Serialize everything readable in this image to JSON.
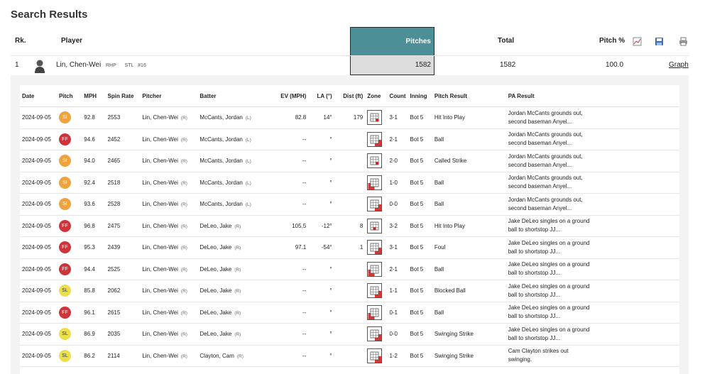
{
  "page_title": "Search Results",
  "header": {
    "rank": "Rk.",
    "player": "Player",
    "pitches": "Pitches",
    "total": "Total",
    "pitch_pct": "Pitch %"
  },
  "summary": {
    "rank": "1",
    "player_name": "Lin, Chen-Wei",
    "throws": "RHP",
    "team": "STL",
    "number": "#16",
    "pitches": "1582",
    "total": "1582",
    "pitch_pct": "100.0",
    "graph_link": "Graph"
  },
  "colors": {
    "accent": "#4c8f96",
    "SI": "#f0a23c",
    "FF": "#d0343b",
    "SL": "#ece04a",
    "zone_fill": "#d02020"
  },
  "columns": [
    "Date",
    "Pitch",
    "MPH",
    "Spin Rate",
    "Pitcher",
    "Batter",
    "EV (MPH)",
    "LA (°)",
    "Dist (ft)",
    "Zone",
    "Count",
    "Inning",
    "Pitch Result",
    "PA Result"
  ],
  "rows": [
    {
      "date": "2024-09-05",
      "pitch": "SI",
      "mph": "92.8",
      "spin": "2553",
      "pitcher": "Lin, Chen-Wei",
      "p_hand": "(R)",
      "batter": "McCants, Jordan",
      "b_hand": "(L)",
      "ev": "82.8",
      "la": "14°",
      "dist": "179",
      "zone": "9",
      "count": "3-1",
      "inning": "Bot 5",
      "result": "Hit Into Play",
      "pa": "Jordan McCants grounds out, second baseman Anyel..."
    },
    {
      "date": "2024-09-05",
      "pitch": "FF",
      "mph": "94.6",
      "spin": "2452",
      "pitcher": "Lin, Chen-Wei",
      "p_hand": "(R)",
      "batter": "McCants, Jordan",
      "b_hand": "(L)",
      "ev": "--",
      "la": "°",
      "dist": "",
      "zone": "14",
      "count": "2-1",
      "inning": "Bot 5",
      "result": "Ball",
      "pa": "Jordan McCants grounds out, second baseman Anyel..."
    },
    {
      "date": "2024-09-05",
      "pitch": "SI",
      "mph": "94.0",
      "spin": "2465",
      "pitcher": "Lin, Chen-Wei",
      "p_hand": "(R)",
      "batter": "McCants, Jordan",
      "b_hand": "(L)",
      "ev": "--",
      "la": "°",
      "dist": "",
      "zone": "9",
      "count": "2-0",
      "inning": "Bot 5",
      "result": "Called Strike",
      "pa": "Jordan McCants grounds out, second baseman Anyel..."
    },
    {
      "date": "2024-09-05",
      "pitch": "SI",
      "mph": "92.4",
      "spin": "2518",
      "pitcher": "Lin, Chen-Wei",
      "p_hand": "(R)",
      "batter": "McCants, Jordan",
      "b_hand": "(L)",
      "ev": "--",
      "la": "°",
      "dist": "",
      "zone": "13",
      "count": "1-0",
      "inning": "Bot 5",
      "result": "Ball",
      "pa": "Jordan McCants grounds out, second baseman Anyel..."
    },
    {
      "date": "2024-09-05",
      "pitch": "SI",
      "mph": "93.6",
      "spin": "2528",
      "pitcher": "Lin, Chen-Wei",
      "p_hand": "(R)",
      "batter": "McCants, Jordan",
      "b_hand": "(L)",
      "ev": "--",
      "la": "°",
      "dist": "",
      "zone": "14",
      "count": "0-0",
      "inning": "Bot 5",
      "result": "Ball",
      "pa": "Jordan McCants grounds out, second baseman Anyel..."
    },
    {
      "date": "2024-09-05",
      "pitch": "FF",
      "mph": "96.8",
      "spin": "2475",
      "pitcher": "Lin, Chen-Wei",
      "p_hand": "(R)",
      "batter": "DeLeo, Jake",
      "b_hand": "(R)",
      "ev": "105.5",
      "la": "-12°",
      "dist": "8",
      "zone": "8",
      "count": "3-2",
      "inning": "Bot 5",
      "result": "Hit Into Play",
      "pa": "Jake DeLeo singles on a ground ball to shortstop JJ..."
    },
    {
      "date": "2024-09-05",
      "pitch": "FF",
      "mph": "95.3",
      "spin": "2439",
      "pitcher": "Lin, Chen-Wei",
      "p_hand": "(R)",
      "batter": "DeLeo, Jake",
      "b_hand": "(R)",
      "ev": "97.1",
      "la": "-54°",
      "dist": "1",
      "zone": "14",
      "count": "3-1",
      "inning": "Bot 5",
      "result": "Foul",
      "pa": "Jake DeLeo singles on a ground ball to shortstop JJ..."
    },
    {
      "date": "2024-09-05",
      "pitch": "FF",
      "mph": "94.4",
      "spin": "2525",
      "pitcher": "Lin, Chen-Wei",
      "p_hand": "(R)",
      "batter": "DeLeo, Jake",
      "b_hand": "(R)",
      "ev": "--",
      "la": "°",
      "dist": "",
      "zone": "13",
      "count": "2-1",
      "inning": "Bot 5",
      "result": "Ball",
      "pa": "Jake DeLeo singles on a ground ball to shortstop JJ..."
    },
    {
      "date": "2024-09-05",
      "pitch": "SL",
      "mph": "85.8",
      "spin": "2062",
      "pitcher": "Lin, Chen-Wei",
      "p_hand": "(R)",
      "batter": "DeLeo, Jake",
      "b_hand": "(R)",
      "ev": "--",
      "la": "°",
      "dist": "",
      "zone": "14",
      "count": "1-1",
      "inning": "Bot 5",
      "result": "Blocked Ball",
      "pa": "Jake DeLeo singles on a ground ball to shortstop JJ..."
    },
    {
      "date": "2024-09-05",
      "pitch": "FF",
      "mph": "96.1",
      "spin": "2615",
      "pitcher": "Lin, Chen-Wei",
      "p_hand": "(R)",
      "batter": "DeLeo, Jake",
      "b_hand": "(R)",
      "ev": "--",
      "la": "°",
      "dist": "",
      "zone": "13",
      "count": "0-1",
      "inning": "Bot 5",
      "result": "Ball",
      "pa": "Jake DeLeo singles on a ground ball to shortstop JJ..."
    },
    {
      "date": "2024-09-05",
      "pitch": "SL",
      "mph": "86.9",
      "spin": "2035",
      "pitcher": "Lin, Chen-Wei",
      "p_hand": "(R)",
      "batter": "DeLeo, Jake",
      "b_hand": "(R)",
      "ev": "--",
      "la": "°",
      "dist": "",
      "zone": "14",
      "count": "0-0",
      "inning": "Bot 5",
      "result": "Swinging Strike",
      "pa": "Jake DeLeo singles on a ground ball to shortstop JJ..."
    },
    {
      "date": "2024-09-05",
      "pitch": "SL",
      "mph": "86.2",
      "spin": "2114",
      "pitcher": "Lin, Chen-Wei",
      "p_hand": "(R)",
      "batter": "Clayton, Cam",
      "b_hand": "(R)",
      "ev": "--",
      "la": "°",
      "dist": "",
      "zone": "14",
      "count": "1-2",
      "inning": "Bot 5",
      "result": "Swinging Strike",
      "pa": "Cam Clayton strikes out swinging."
    }
  ]
}
